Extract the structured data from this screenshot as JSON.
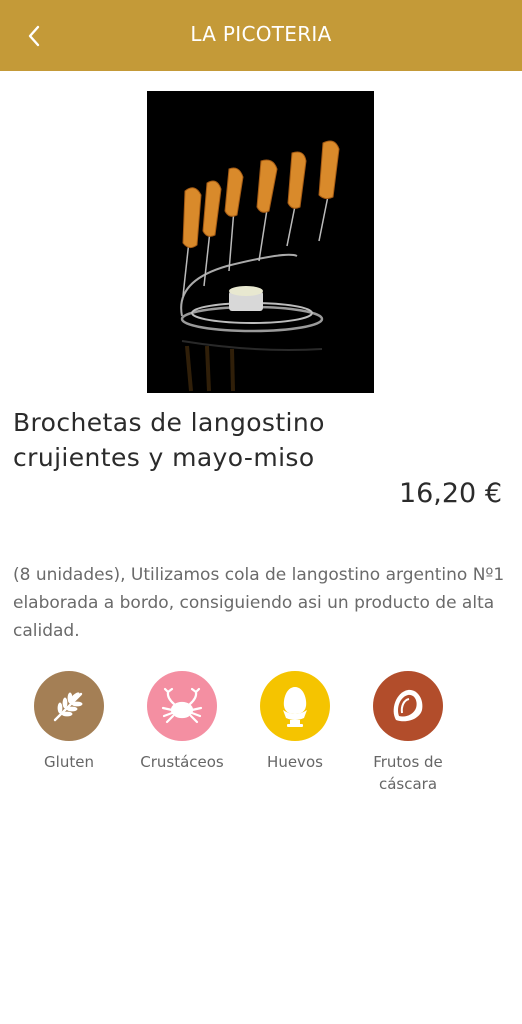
{
  "header": {
    "title": "LA PICOTERIA",
    "accent_color": "#c49a38"
  },
  "product": {
    "name": "Brochetas de langostino crujientes y mayo-miso",
    "price": "16,20 €",
    "description": "(8 unidades), Utilizamos cola de langostino argentino Nº1 elaborada a bordo, consiguiendo asi un producto de alta calidad."
  },
  "allergens": [
    {
      "label": "Gluten",
      "icon": "wheat-icon",
      "color": "#a47f55"
    },
    {
      "label": "Crustáceos",
      "icon": "crab-icon",
      "color": "#f48fa2"
    },
    {
      "label": "Huevos",
      "icon": "egg-icon",
      "color": "#f5c400"
    },
    {
      "label": "Frutos de cáscara",
      "icon": "nut-icon",
      "color": "#b24d2b"
    }
  ]
}
